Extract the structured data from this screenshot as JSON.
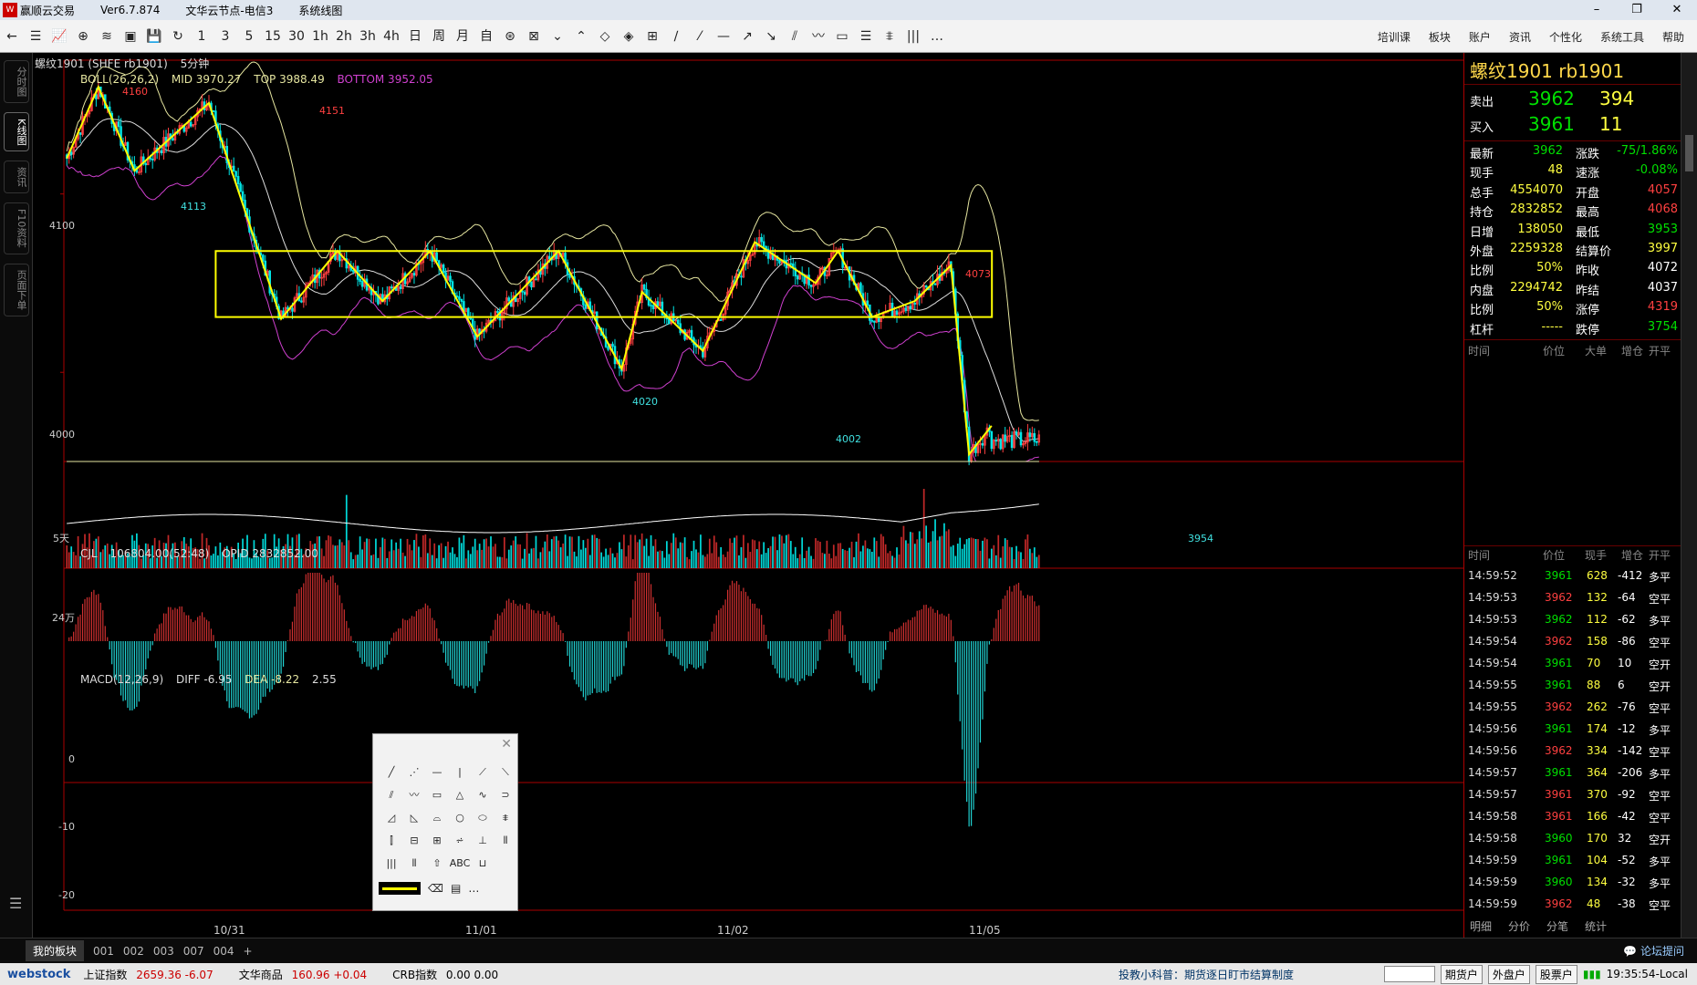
{
  "titlebar": {
    "app": "赢顺云交易",
    "version": "Ver6.7.874",
    "server": "文华云节点-电信3",
    "panel": "系统线图",
    "min": "–",
    "max": "❐",
    "close": "✕"
  },
  "toolbar": {
    "buttons": [
      "←",
      "☰",
      "📈",
      "⊕",
      "≋",
      "▣",
      "💾",
      "↻",
      "1",
      "3",
      "5",
      "15",
      "30",
      "1h",
      "2h",
      "3h",
      "4h",
      "日",
      "周",
      "月",
      "自",
      "⊛",
      "⊠",
      "⌄",
      "⌃",
      "◇",
      "◈",
      "⊞",
      "∕",
      "⁄",
      "—",
      "↗",
      "↘",
      "⫽",
      "〰",
      "▭",
      "☰",
      "⩨",
      "|||",
      "…"
    ],
    "menus": [
      "培训课",
      "板块",
      "账户",
      "资讯",
      "个性化",
      "系统工具",
      "帮助"
    ]
  },
  "left_tabs": [
    "分时图",
    "K线图",
    "资讯",
    "F10资料",
    "页面下单"
  ],
  "chart": {
    "contract_tag": "螺纹1901 (SHFE rb1901)",
    "period": "5分钟",
    "boll_name": "BOLL(26,26,2)",
    "boll_mid": "MID 3970.27",
    "boll_top": "TOP 3988.49",
    "boll_bottom": "BOTTOM 3952.05",
    "cjl_name": "CJL",
    "cjl_value": "106804.00(52:48)",
    "opid": "OPID 2832852.00",
    "macd_name": "MACD(12,26,9)",
    "macd_diff": "DIFF -6.95",
    "macd_dea": "DEA -8.22",
    "macd_val": "2.55",
    "days_label": "5天",
    "price_axis": [
      "4100",
      "4000"
    ],
    "vol_axis": "24万",
    "macd_axis": [
      "0",
      "-10",
      "-20"
    ],
    "dates": [
      "10/31",
      "11/01",
      "11/02",
      "11/05"
    ],
    "points": [
      "4160",
      "4151",
      "4113",
      "4073",
      "4020",
      "4002",
      "3954"
    ]
  },
  "chart_data": {
    "type": "candlestick",
    "y_range": [
      3950,
      4175
    ],
    "price_labels": [
      4100,
      4000
    ],
    "zigzag_pivots": [
      4113,
      4160,
      4113,
      4151,
      4040,
      4020,
      4060,
      4002,
      4040,
      4073,
      3954
    ],
    "pivots_labelled": {
      "high": [
        4160,
        4151,
        4073
      ],
      "low": [
        4113,
        4020,
        4002,
        3954
      ]
    },
    "range_box": {
      "top": 4068,
      "bottom": 4031
    },
    "macd_range": [
      -22,
      8
    ]
  },
  "quote": {
    "title": "螺纹1901  rb1901",
    "ask_label": "卖出",
    "ask_price": "3962",
    "ask_vol": "394",
    "bid_label": "买入",
    "bid_price": "3961",
    "bid_vol": "11",
    "rows": [
      {
        "l1": "最新",
        "v1": "3962",
        "c1": "#00e000",
        "l2": "涨跌",
        "v2": "-75/1.86%",
        "c2": "#00e000"
      },
      {
        "l1": "现手",
        "v1": "48",
        "c1": "#ffff40",
        "l2": "速涨",
        "v2": "-0.08%",
        "c2": "#00e000"
      },
      {
        "l1": "总手",
        "v1": "4554070",
        "c1": "#ffff40",
        "l2": "开盘",
        "v2": "4057",
        "c2": "#ff4040"
      },
      {
        "l1": "持仓",
        "v1": "2832852",
        "c1": "#ffff40",
        "l2": "最高",
        "v2": "4068",
        "c2": "#ff4040"
      },
      {
        "l1": "日增",
        "v1": "138050",
        "c1": "#ffff40",
        "l2": "最低",
        "v2": "3953",
        "c2": "#00e000"
      },
      {
        "l1": "外盘",
        "v1": "2259328",
        "c1": "#ffff40",
        "l2": "结算价",
        "v2": "3997",
        "c2": "#ffff40"
      },
      {
        "l1": "比例",
        "v1": "50%",
        "c1": "#ffff40",
        "l2": "昨收",
        "v2": "4072",
        "c2": "#ffffff"
      },
      {
        "l1": "内盘",
        "v1": "2294742",
        "c1": "#ffff40",
        "l2": "昨结",
        "v2": "4037",
        "c2": "#ffffff"
      },
      {
        "l1": "比例",
        "v1": "50%",
        "c1": "#ffff40",
        "l2": "涨停",
        "v2": "4319",
        "c2": "#ff4040"
      },
      {
        "l1": "杠杆",
        "v1": "-----",
        "c1": "#ffff40",
        "l2": "跌停",
        "v2": "3754",
        "c2": "#00e000"
      }
    ],
    "header1": [
      "时间",
      "价位",
      "大单",
      "增仓",
      "开平"
    ],
    "header2": [
      "时间",
      "价位",
      "现手",
      "增仓",
      "开平"
    ],
    "ticks": [
      {
        "t": "14:59:52",
        "p": "3961",
        "v": "628",
        "d": "-412",
        "k": "多平",
        "pc": "#00e000"
      },
      {
        "t": "14:59:53",
        "p": "3962",
        "v": "132",
        "d": "-64",
        "k": "空平",
        "pc": "#ff4040"
      },
      {
        "t": "14:59:53",
        "p": "3962",
        "v": "112",
        "d": "-62",
        "k": "多平",
        "pc": "#00e000"
      },
      {
        "t": "14:59:54",
        "p": "3962",
        "v": "158",
        "d": "-86",
        "k": "空平",
        "pc": "#ff4040"
      },
      {
        "t": "14:59:54",
        "p": "3961",
        "v": "70",
        "d": "10",
        "k": "空开",
        "pc": "#00e000"
      },
      {
        "t": "14:59:55",
        "p": "3961",
        "v": "88",
        "d": "6",
        "k": "空开",
        "pc": "#00e000"
      },
      {
        "t": "14:59:55",
        "p": "3962",
        "v": "262",
        "d": "-76",
        "k": "空平",
        "pc": "#ff4040"
      },
      {
        "t": "14:59:56",
        "p": "3961",
        "v": "174",
        "d": "-12",
        "k": "多平",
        "pc": "#00e000"
      },
      {
        "t": "14:59:56",
        "p": "3962",
        "v": "334",
        "d": "-142",
        "k": "空平",
        "pc": "#ff4040"
      },
      {
        "t": "14:59:57",
        "p": "3961",
        "v": "364",
        "d": "-206",
        "k": "多平",
        "pc": "#00e000"
      },
      {
        "t": "14:59:57",
        "p": "3961",
        "v": "370",
        "d": "-92",
        "k": "空平",
        "pc": "#ff4040"
      },
      {
        "t": "14:59:58",
        "p": "3961",
        "v": "166",
        "d": "-42",
        "k": "空平",
        "pc": "#ff4040"
      },
      {
        "t": "14:59:58",
        "p": "3960",
        "v": "170",
        "d": "32",
        "k": "空开",
        "pc": "#00e000"
      },
      {
        "t": "14:59:59",
        "p": "3961",
        "v": "104",
        "d": "-52",
        "k": "多平",
        "pc": "#00e000"
      },
      {
        "t": "14:59:59",
        "p": "3960",
        "v": "134",
        "d": "-32",
        "k": "多平",
        "pc": "#00e000"
      },
      {
        "t": "14:59:59",
        "p": "3962",
        "v": "48",
        "d": "-38",
        "k": "空平",
        "pc": "#ff4040"
      }
    ],
    "tabs": [
      "明细",
      "分价",
      "分笔",
      "统计"
    ]
  },
  "drawbox": {
    "tools": [
      "╱",
      "⋰",
      "—",
      "|",
      "⟋",
      "⟍",
      "⫽",
      "〰",
      "▭",
      "△",
      "∿",
      "⊃",
      "◿",
      "◺",
      "⌓",
      "○",
      "⬭",
      "⩨",
      "⫿",
      "⊟",
      "⊞",
      "⩫",
      "⊥",
      "⦀",
      "|||",
      "⦀",
      "⇧",
      "ABC",
      "⊔"
    ],
    "eraser": "⌫",
    "palette": "▤",
    "more": "…",
    "close": "✕"
  },
  "bottom_tabs": [
    "我的板块",
    "001",
    "002",
    "003",
    "007",
    "004",
    "+"
  ],
  "forum": "论坛提问",
  "status": {
    "brand": "webstock",
    "sh_label": "上证指数",
    "sh_value": "2659.36 -6.07",
    "wh_label": "文华商品",
    "wh_value": "160.96 +0.04",
    "crb_label": "CRB指数",
    "crb_value": "0.00 0.00",
    "tip": "投教小科普：期货逐日盯市结算制度",
    "buttons": [
      "期货户",
      "外盘户",
      "股票户"
    ],
    "clock": "19:35:54-Local"
  },
  "colors": {
    "up": "#ff4040",
    "down": "#00e5e5",
    "boll": "#e6e6a0",
    "boll_low": "#d040d0",
    "zigzag": "#ffff00"
  }
}
